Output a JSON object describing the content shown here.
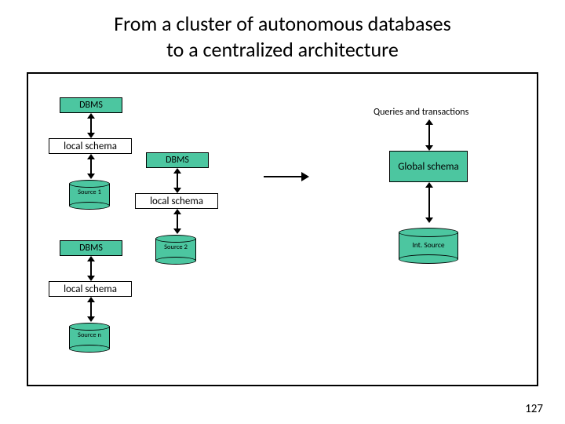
{
  "title_line1": "From a cluster of autonomous databases",
  "title_line2": "to a centralized architecture",
  "labels": {
    "dbms": "DBMS",
    "local_schema": "local schema",
    "global_schema": "Global schema",
    "queries": "Queries and transactions",
    "source1": "Source 1",
    "source2": "Source 2",
    "sourcen": "Source n",
    "int_source": "Int. Source"
  },
  "page_number": "127"
}
